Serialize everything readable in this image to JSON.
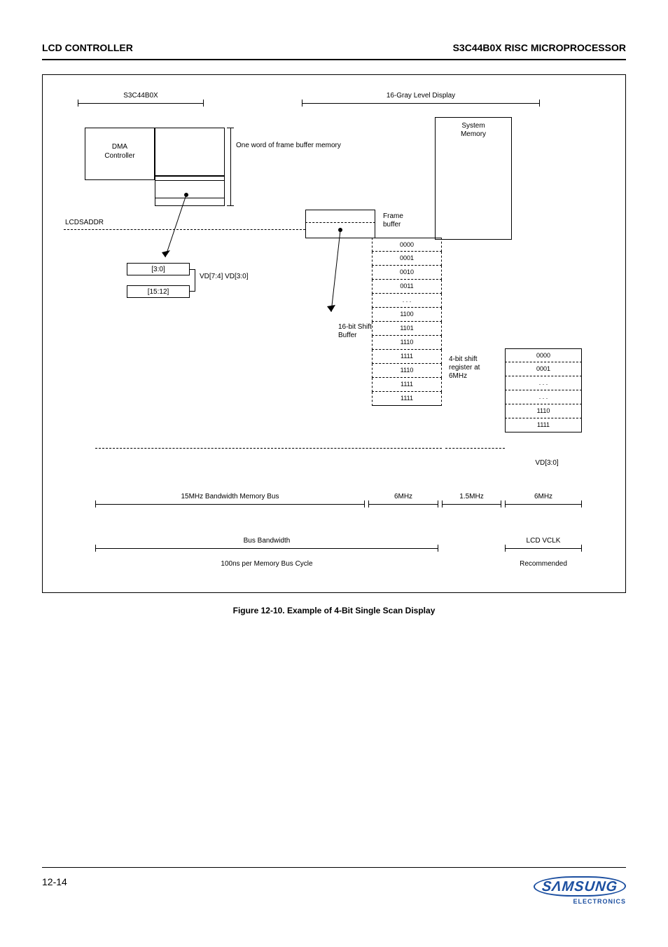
{
  "header": {
    "left": "LCD CONTROLLER",
    "right": "S3C44B0X RISC MICROPROCESSOR"
  },
  "figure": {
    "top_left_bracket": "S3C44B0X",
    "top_right_bracket": "16-Gray Level Display",
    "dma_box_title": "DMA\nController",
    "system_memory_title": "System\nMemory",
    "frame_buffer_label1": "One word of frame buffer memory",
    "frame_buffer_label2": "Frame\nbuffer",
    "lcdsaddr": "LCDSADDR",
    "dp_small": "[3:0]",
    "dp_big": "[15:12]",
    "buffer_left": "16-bit Shift\nBuffer",
    "buffer_right": "4-bit shift\nregister at\n6MHz",
    "cells": {
      "c0": "0000",
      "c1": "0001",
      "c2": "0010",
      "c3": "0011",
      "dots": ". . .",
      "c12": "1100",
      "c13": "1101",
      "c14": "1110",
      "c15": "1111"
    },
    "right_cells": {
      "r0": "0000",
      "r1": "0001",
      "rdots1": ". . .",
      "rdots2": ". . .",
      "r14": "1110",
      "r15": "1111"
    },
    "bottom_b1": "15MHz Bandwidth Memory Bus",
    "bottom_b1b": "6MHz",
    "bottom_b2": "1.5MHz",
    "bottom_b3": "6MHz",
    "bottom_c1": "Bus Bandwidth",
    "bottom_c2": "LCD VCLK",
    "bottom_vd": "VD[3:0]",
    "bottom_note": "100ns per Memory Bus Cycle",
    "vd_label": "VD[7:4] VD[3:0]",
    "recommended": "Recommended"
  },
  "caption": "Figure 12-10. Example of 4-Bit Single Scan Display",
  "footer": {
    "page": "12-14"
  }
}
